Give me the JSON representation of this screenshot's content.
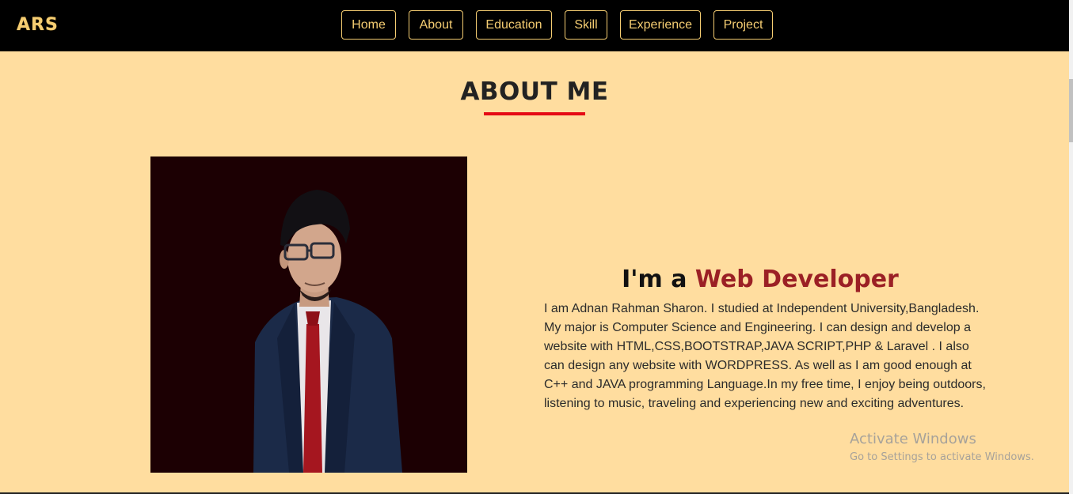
{
  "nav": {
    "brand": "ARS",
    "links": [
      "Home",
      "About",
      "Education",
      "Skill",
      "Experience",
      "Project"
    ]
  },
  "about": {
    "title": "ABOUT ME",
    "headline_prefix": "I'm a ",
    "headline_accent": "Web Developer",
    "bio": "I am Adnan Rahman Sharon. I studied at Independent University,Bangladesh. My major is Computer Science and Engineering. I can design and develop a website with HTML,CSS,BOOTSTRAP,JAVA SCRIPT,PHP & Laravel . I also can design any website with WORDPRESS. As well as I am good enough at C++ and JAVA programming Language.In my free time, I enjoy being outdoors, listening to music, traveling and experiencing new and exciting adventures."
  },
  "watermark": {
    "title": "Activate Windows",
    "subtitle": "Go to Settings to activate Windows."
  },
  "colors": {
    "nav_bg": "#000000",
    "accent_gold": "#f5cd72",
    "page_bg": "#ffdd9f",
    "underline_red": "#e50914",
    "headline_accent": "#9b2025"
  }
}
